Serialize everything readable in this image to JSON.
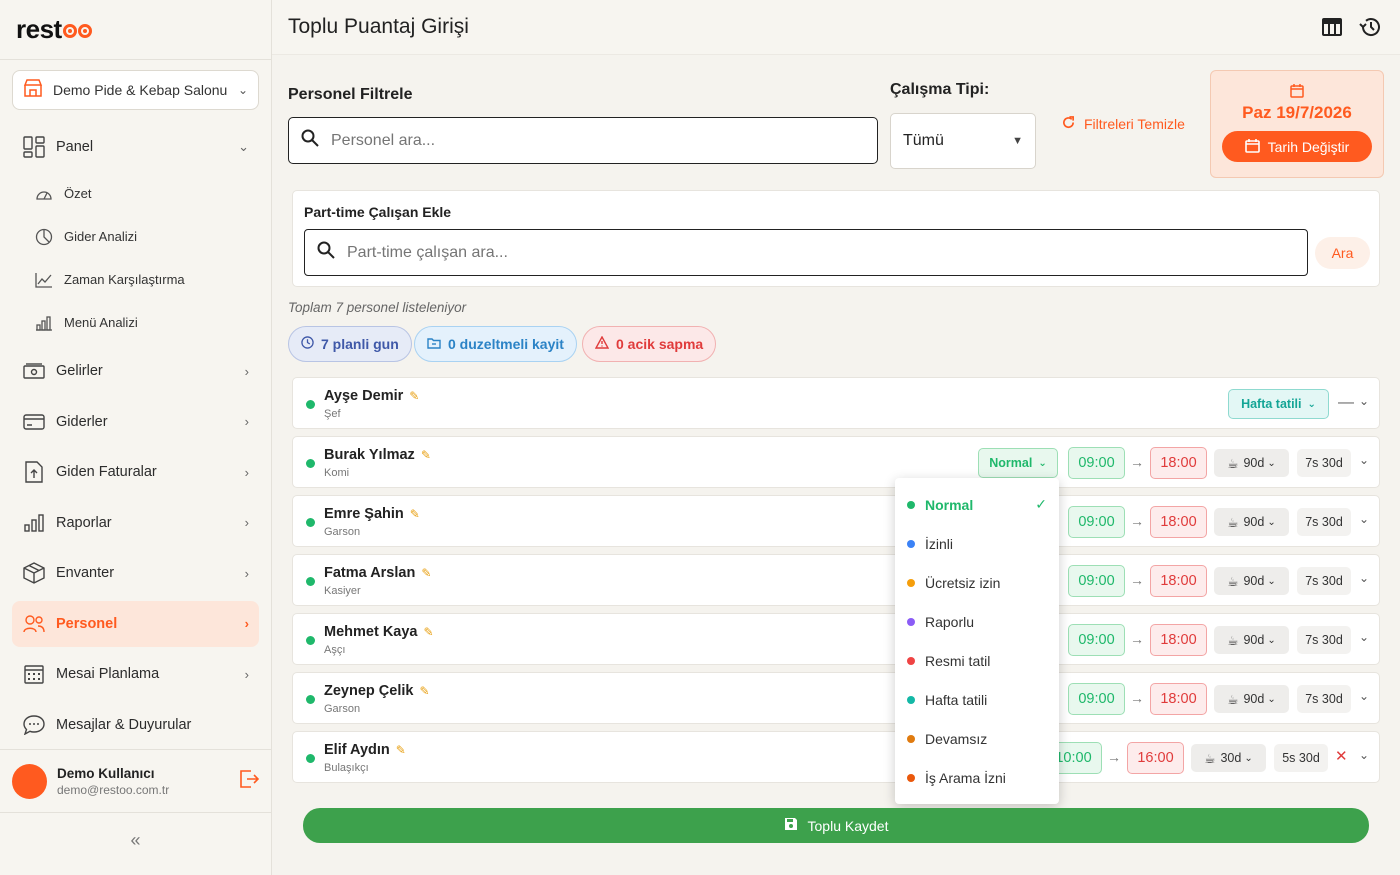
{
  "app": {
    "logo": "restoo"
  },
  "sidebar": {
    "store": "Demo Pide & Kebap Salonu",
    "items": [
      {
        "label": "Panel",
        "icon": "dashboard-icon",
        "expanded": true
      },
      {
        "label": "Gelirler",
        "icon": "cash-icon"
      },
      {
        "label": "Giderler",
        "icon": "card-icon"
      },
      {
        "label": "Giden Faturalar",
        "icon": "upload-file-icon"
      },
      {
        "label": "Raporlar",
        "icon": "bar-chart-icon"
      },
      {
        "label": "Envanter",
        "icon": "box-icon"
      },
      {
        "label": "Personel",
        "icon": "people-icon",
        "active": true
      },
      {
        "label": "Mesai Planlama",
        "icon": "calendar-icon"
      },
      {
        "label": "Mesajlar & Duyurular",
        "icon": "chat-icon"
      }
    ],
    "sub_items": [
      {
        "label": "Özet",
        "icon": "speedometer-icon"
      },
      {
        "label": "Gider Analizi",
        "icon": "pie-icon"
      },
      {
        "label": "Zaman Karşılaştırma",
        "icon": "trend-icon"
      },
      {
        "label": "Menü Analizi",
        "icon": "bars-icon"
      }
    ],
    "user": {
      "name": "Demo Kullanıcı",
      "email": "demo@restoo.com.tr"
    },
    "collapse": "«"
  },
  "header": {
    "title": "Toplu Puantaj Girişi"
  },
  "filters": {
    "personnel_label": "Personel Filtrele",
    "personnel_placeholder": "Personel ara...",
    "work_type_label": "Çalışma Tipi:",
    "work_type_value": "Tümü",
    "clear_label": "Filtreleri Temizle",
    "date": "Paz 19/7/2026",
    "change_date": "Tarih Değiştir"
  },
  "parttime": {
    "title": "Part-time Çalışan Ekle",
    "placeholder": "Part-time çalışan ara...",
    "search_button": "Ara"
  },
  "summary": {
    "total": "Toplam 7 personel listeleniyor",
    "planned": "7 planli gun",
    "edited": "0 duzeltmeli kayit",
    "deviation": "0 acik sapma"
  },
  "employees": [
    {
      "name": "Ayşe Demir",
      "role": "Şef",
      "status": "Hafta tatili"
    },
    {
      "name": "Burak Yılmaz",
      "role": "Komi",
      "status": "Normal",
      "start": "09:00",
      "end": "18:00",
      "break": "90d",
      "duration": "7s 30d"
    },
    {
      "name": "Emre Şahin",
      "role": "Garson",
      "start": "09:00",
      "end": "18:00",
      "break": "90d",
      "duration": "7s 30d"
    },
    {
      "name": "Fatma Arslan",
      "role": "Kasiyer",
      "start": "09:00",
      "end": "18:00",
      "break": "90d",
      "duration": "7s 30d"
    },
    {
      "name": "Mehmet Kaya",
      "role": "Aşçı",
      "start": "09:00",
      "end": "18:00",
      "break": "90d",
      "duration": "7s 30d"
    },
    {
      "name": "Zeynep Çelik",
      "role": "Garson",
      "start": "09:00",
      "end": "18:00",
      "break": "90d",
      "duration": "7s 30d"
    },
    {
      "name": "Elif Aydın",
      "role": "Bulaşıkçı",
      "start": "10:00",
      "end": "16:00",
      "break": "30d",
      "duration": "5s 30d"
    }
  ],
  "status_options": [
    {
      "label": "Normal",
      "color": "#1fb86b",
      "selected": true
    },
    {
      "label": "İzinli",
      "color": "#3b82f6"
    },
    {
      "label": "Ücretsiz izin",
      "color": "#f59e0b"
    },
    {
      "label": "Raporlu",
      "color": "#8b5cf6"
    },
    {
      "label": "Resmi tatil",
      "color": "#ef4444"
    },
    {
      "label": "Hafta tatili",
      "color": "#14b8a6"
    },
    {
      "label": "Devamsız",
      "color": "#e07b0f"
    },
    {
      "label": "İş Arama İzni",
      "color": "#ea580c"
    }
  ],
  "save": {
    "label": "Toplu Kaydet"
  },
  "colors": {
    "accent": "#ff5a1f",
    "success": "#3da14c"
  }
}
